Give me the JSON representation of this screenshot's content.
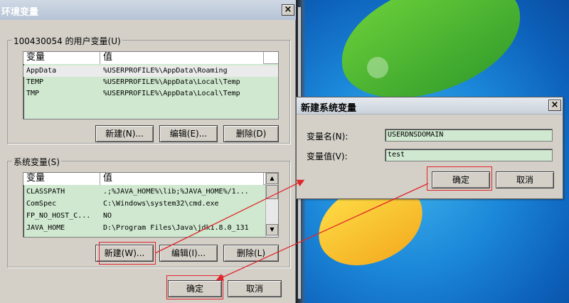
{
  "env_dialog": {
    "title": "环境变量",
    "user_group": {
      "label": "100430054 的用户变量(U)",
      "columns": [
        "变量",
        "值"
      ],
      "rows": [
        {
          "name": "AppData",
          "value": "%USERPROFILE%\\AppData\\Roaming"
        },
        {
          "name": "TEMP",
          "value": "%USERPROFILE%\\AppData\\Local\\Temp"
        },
        {
          "name": "TMP",
          "value": "%USERPROFILE%\\AppData\\Local\\Temp"
        }
      ],
      "new_label": "新建(N)...",
      "edit_label": "编辑(E)...",
      "delete_label": "删除(D)"
    },
    "system_group": {
      "label": "系统变量(S)",
      "columns": [
        "变量",
        "值"
      ],
      "rows": [
        {
          "name": "CLASSPATH",
          "value": ".;%JAVA_HOME%\\lib;%JAVA_HOME%/1..."
        },
        {
          "name": "ComSpec",
          "value": "C:\\Windows\\system32\\cmd.exe"
        },
        {
          "name": "FP_NO_HOST_C...",
          "value": "NO"
        },
        {
          "name": "JAVA_HOME",
          "value": "D:\\Program Files\\Java\\jdk1.8.0_131"
        }
      ],
      "new_label": "新建(W)...",
      "edit_label": "编辑(I)...",
      "delete_label": "删除(L)"
    },
    "ok_label": "确定",
    "cancel_label": "取消"
  },
  "new_var_dialog": {
    "title": "新建系统变量",
    "name_label": "变量名(N):",
    "name_value": "USERDNSDOMAIN",
    "value_label": "变量值(V):",
    "value_value": "test",
    "ok_label": "确定",
    "cancel_label": "取消"
  },
  "close_glyph": "×",
  "colors": {
    "highlight": "#e0262c",
    "list_bg": "#cfe8cf",
    "dialog_bg": "#d4d0c8"
  }
}
